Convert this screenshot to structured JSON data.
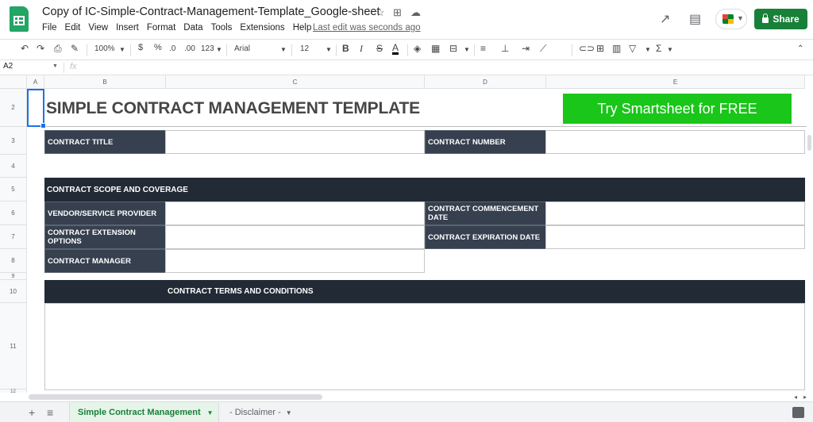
{
  "app": {
    "doc_title": "Copy of IC-Simple-Contract-Management-Template_Google-sheet",
    "menu": [
      "File",
      "Edit",
      "View",
      "Insert",
      "Format",
      "Data",
      "Tools",
      "Extensions",
      "Help"
    ],
    "last_edit": "Last edit was seconds ago",
    "share_label": "Share",
    "brand_color": "#188038"
  },
  "toolbar": {
    "zoom": "100%",
    "currency": "$",
    "percent": "%",
    "dec_decrease": ".0",
    "dec_increase": ".00",
    "more_formats": "123",
    "font": "Arial",
    "font_size": "12",
    "bold": "B",
    "italic": "I",
    "strike": "S",
    "text_color": "A",
    "sigma": "Σ"
  },
  "formula_bar": {
    "name_box": "A2",
    "fx": "fx"
  },
  "grid": {
    "columns": [
      "A",
      "B",
      "C",
      "D",
      "E"
    ],
    "rows": [
      "2",
      "3",
      "4",
      "5",
      "6",
      "7",
      "8",
      "9",
      "10",
      "11",
      "12"
    ],
    "title": "SIMPLE CONTRACT MANAGEMENT TEMPLATE",
    "cta": "Try Smartsheet for FREE",
    "contract_title": "CONTRACT TITLE",
    "contract_number": "CONTRACT NUMBER",
    "scope_banner": "CONTRACT SCOPE AND COVERAGE",
    "vendor": "VENDOR/SERVICE PROVIDER",
    "commencement": "CONTRACT COMMENCEMENT DATE",
    "extension": "CONTRACT EXTENSION OPTIONS",
    "expiration": "CONTRACT EXPIRATION DATE",
    "manager": "CONTRACT MANAGER",
    "terms_banner": "CONTRACT TERMS AND CONDITIONS"
  },
  "sheets": {
    "active": "Simple Contract Management",
    "other": "- Disclaimer -"
  }
}
